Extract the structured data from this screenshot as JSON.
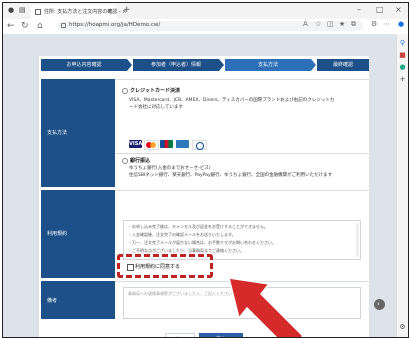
{
  "browser": {
    "tab_title": "住所: 支払方法と注文内容の確認 - ×",
    "url": "https://hoapmi.org/ja/HDemo.cw/",
    "window": {
      "min": "–",
      "max": "□",
      "close": "×"
    }
  },
  "steps": [
    {
      "label": "お申込内容確認"
    },
    {
      "label": "参加者（申込者）情報"
    },
    {
      "label": "支払方法"
    },
    {
      "label": "最終確認"
    }
  ],
  "payment": {
    "section_label": "支払方法",
    "credit": {
      "title": "クレジットカード決済",
      "desc1": "VISA、Mastercard、JCB、AMEX、Diners、ディスカバーの国際ブランドおよび右記のクレジットカ",
      "desc2": "ード会社に対応しています"
    },
    "card_brands": [
      "VISA",
      "Mastercard",
      "JCB",
      "AMEX",
      "Diners"
    ],
    "bank": {
      "title": "銀行振込",
      "desc1": "ゆうちょ銀行(入金のまでおせーせ-ビス)",
      "desc2": "住信SBIネット銀行、楽天銀行、PayPay銀行、ゆうちょ銀行、全国の金融機関がご利用いただけます"
    }
  },
  "terms": {
    "section_label": "利用規約",
    "lines": [
      "・お申し込み完了後は、キャンセル及び返金をお受けすることができません。",
      "・入金確認後、注文完了の確認メールをお送りいたします。",
      "・万一、注文完了メールが届かない場合は、お手数ですがお問い合わせください。",
      "・ご不明な点がございましたら、当事務局までご連絡ください。"
    ],
    "agree_label": "利用規約に同意する"
  },
  "remarks": {
    "section_label": "備考",
    "placeholder": "事務局への連絡事項等がございましたら、ご記入ください。"
  },
  "buttons": {
    "back": "戻る",
    "next": "次へ"
  },
  "colors": {
    "brand": "#1d4f88",
    "annotation": "#d62a2a"
  }
}
